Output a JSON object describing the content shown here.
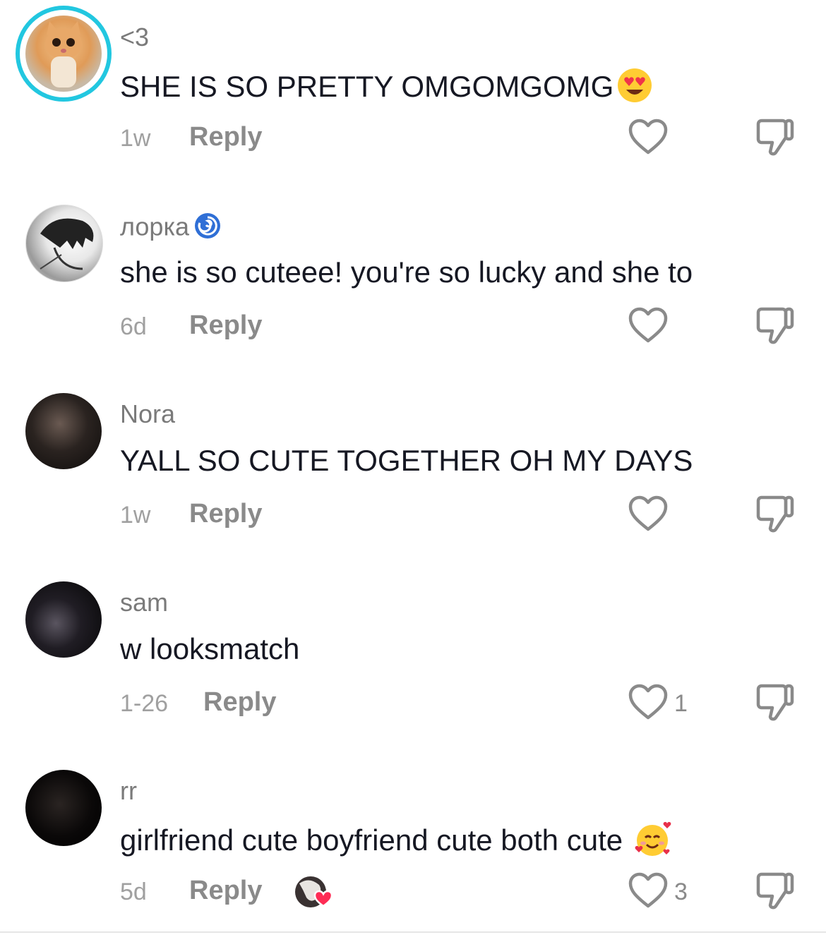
{
  "comments": [
    {
      "username": "<3",
      "text": "SHE IS SO PRETTY OMGOMGOMG",
      "text_emoji": "heart-eyes-emoji",
      "time": "1w",
      "reply": "Reply",
      "likes": ""
    },
    {
      "username": "лорка",
      "username_emoji": "cyclone-emoji",
      "text": "she is so cuteee! you're so lucky and she to",
      "time": "6d",
      "reply": "Reply",
      "likes": ""
    },
    {
      "username": "Nora",
      "text": "YALL SO CUTE TOGETHER OH MY DAYS",
      "time": "1w",
      "reply": "Reply",
      "likes": ""
    },
    {
      "username": "sam",
      "text": "w looksmatch",
      "time": "1-26",
      "reply": "Reply",
      "likes": "1"
    },
    {
      "username": "rr",
      "text": "girlfriend cute boyfriend cute both cute",
      "text_emoji": "smiling-face-with-hearts-emoji",
      "time": "5d",
      "reply": "Reply",
      "likes": "3"
    }
  ],
  "colors": {
    "story_ring": "#22c7e0",
    "primary_text": "#161823",
    "secondary_text": "#8a8a8a",
    "creator_like": "#fe2c55"
  }
}
